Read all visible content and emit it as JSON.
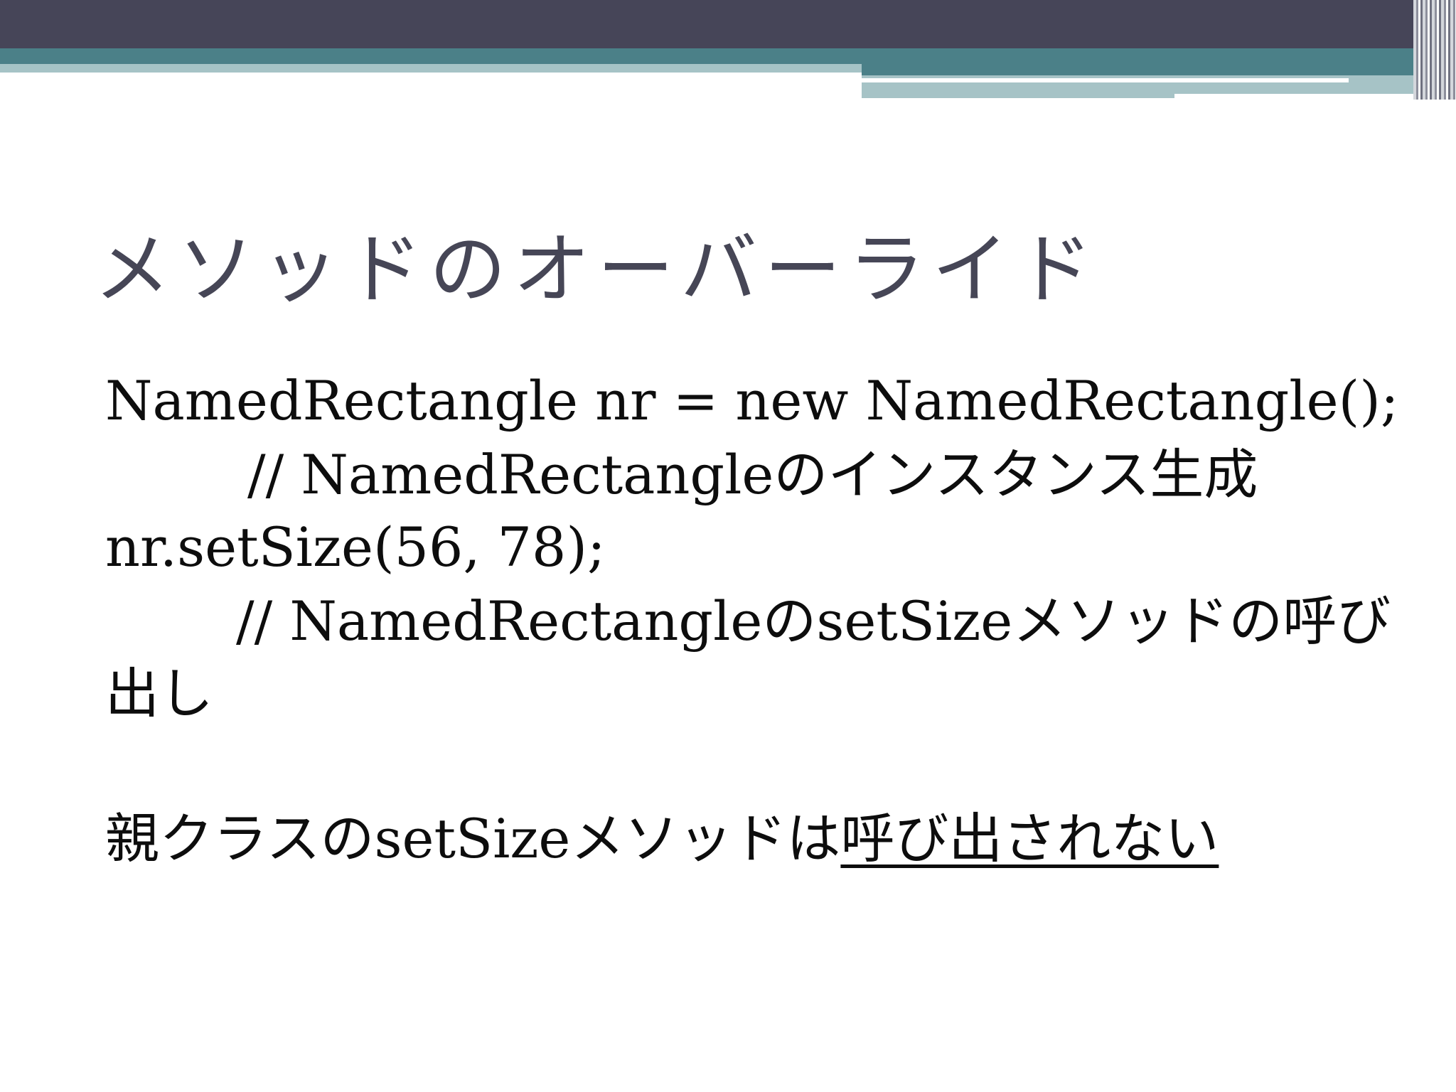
{
  "colors": {
    "header_dark": "#464558",
    "header_teal": "#4b8088",
    "header_light": "#a6c3c6",
    "title_text": "#464656",
    "body_text": "#0d0d0d"
  },
  "slide": {
    "title": "メソッドのオーバーライド",
    "lines": [
      "NamedRectangle nr = new NamedRectangle();",
      "// NamedRectangleのインスタンス生成",
      "nr.setSize(56, 78);",
      "// NamedRectangleのsetSizeメソッドの呼び",
      "出し"
    ],
    "conclusion": {
      "plain": "親クラスのsetSizeメソッドは",
      "underlined": "呼び出されない"
    }
  }
}
